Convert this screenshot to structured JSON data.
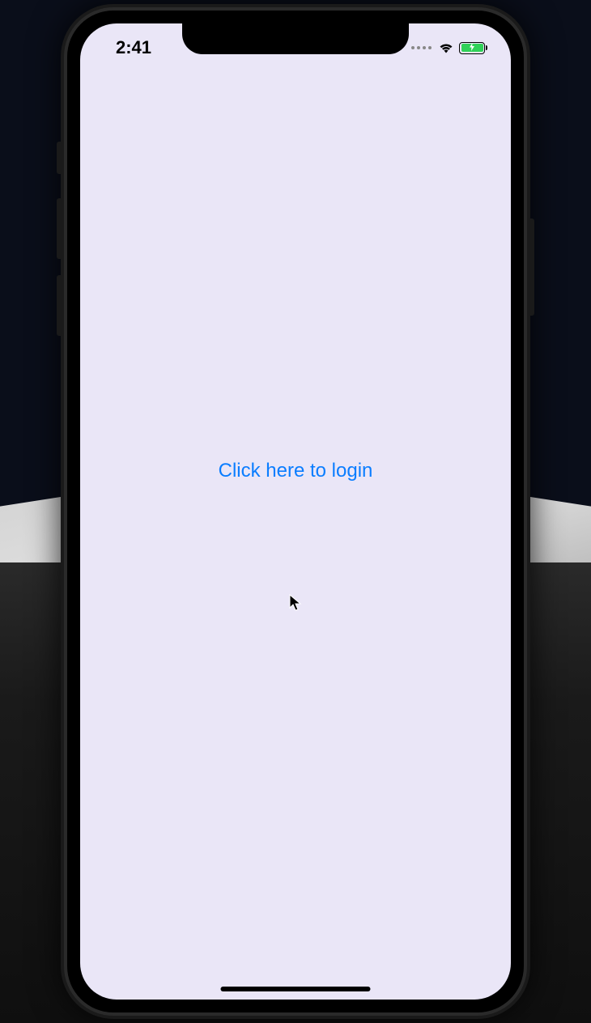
{
  "status_bar": {
    "time": "2:41"
  },
  "main": {
    "login_button_label": "Click here to login"
  }
}
